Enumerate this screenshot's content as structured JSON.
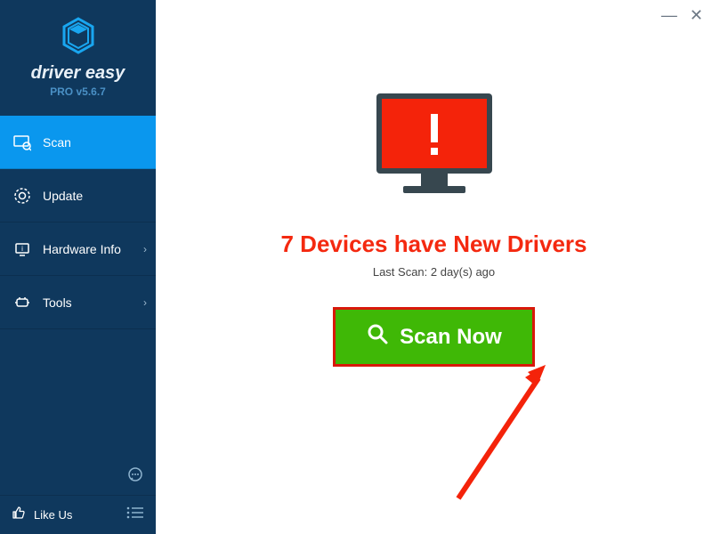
{
  "brand": {
    "name": "driver easy",
    "version": "PRO v5.6.7"
  },
  "sidebar": {
    "items": [
      {
        "label": "Scan",
        "icon": "scan-icon",
        "has_chevron": false
      },
      {
        "label": "Update",
        "icon": "update-icon",
        "has_chevron": false
      },
      {
        "label": "Hardware Info",
        "icon": "hardware-icon",
        "has_chevron": true
      },
      {
        "label": "Tools",
        "icon": "tools-icon",
        "has_chevron": true
      }
    ],
    "active_index": 0,
    "like_label": "Like Us"
  },
  "main": {
    "headline": "7 Devices have New Drivers",
    "last_scan": "Last Scan: 2 day(s) ago",
    "scan_button": "Scan Now"
  },
  "colors": {
    "accent": "#0a97ee",
    "sidebar_bg": "#0f385d",
    "danger": "#f42910",
    "success": "#3fb806"
  }
}
